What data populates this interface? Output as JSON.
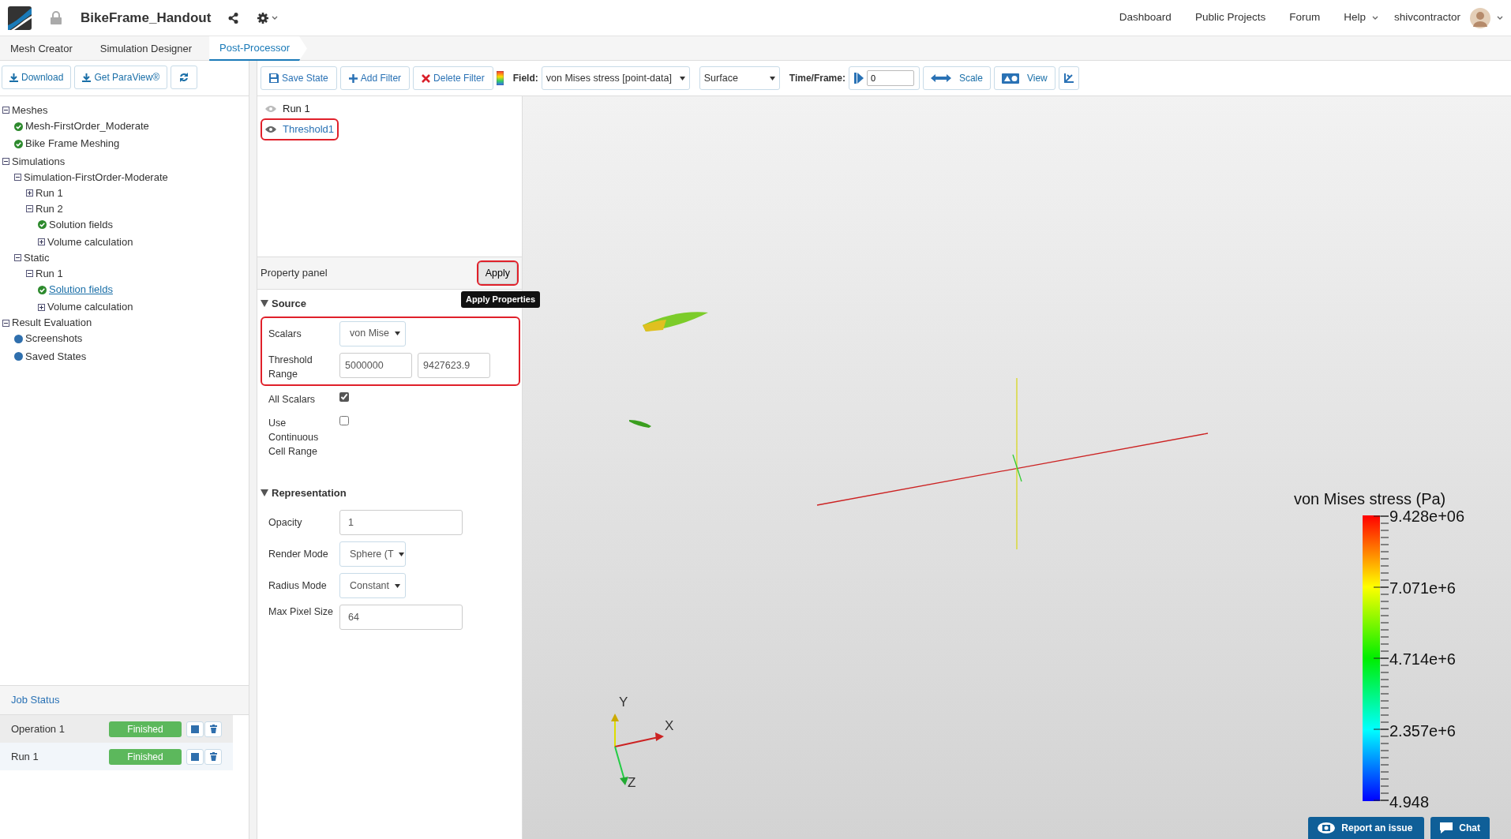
{
  "header": {
    "project_title": "BikeFrame_Handout",
    "nav_links": [
      "Dashboard",
      "Public Projects",
      "Forum",
      "Help"
    ],
    "username": "shivcontractor"
  },
  "tabs": [
    {
      "label": "Mesh Creator",
      "selected": false
    },
    {
      "label": "Simulation Designer",
      "selected": false
    },
    {
      "label": "Post-Processor",
      "selected": true
    }
  ],
  "left_toolbar": {
    "buttons": [
      "Download",
      "Get ParaView®"
    ]
  },
  "tree": [
    {
      "label": "Meshes",
      "kind": "group",
      "expanded": true,
      "selected": false,
      "children": [
        {
          "label": "Mesh-FirstOrder_Moderate",
          "kind": "done",
          "selected": false
        },
        {
          "label": "Bike Frame Meshing",
          "kind": "done",
          "selected": false
        }
      ]
    },
    {
      "label": "Simulations",
      "kind": "group",
      "expanded": true,
      "selected": false,
      "children": [
        {
          "label": "Simulation-FirstOrder-Moderate",
          "kind": "group",
          "expanded": true,
          "selected": false,
          "children": [
            {
              "label": "Run 1",
              "kind": "group",
              "expanded": false,
              "selected": false
            },
            {
              "label": "Run 2",
              "kind": "group",
              "expanded": true,
              "selected": false,
              "children": [
                {
                  "label": "Solution fields",
                  "kind": "done",
                  "selected": false
                },
                {
                  "label": "Volume calculation",
                  "kind": "group",
                  "expanded": false,
                  "selected": false
                }
              ]
            }
          ]
        },
        {
          "label": "Static",
          "kind": "group",
          "expanded": true,
          "selected": false,
          "children": [
            {
              "label": "Run 1",
              "kind": "group",
              "expanded": true,
              "selected": false,
              "children": [
                {
                  "label": "Solution fields",
                  "kind": "done",
                  "selected": true
                },
                {
                  "label": "Volume calculation",
                  "kind": "group",
                  "expanded": false,
                  "selected": false
                }
              ]
            }
          ]
        }
      ]
    },
    {
      "label": "Result Evaluation",
      "kind": "group",
      "expanded": true,
      "selected": false,
      "children": [
        {
          "label": "Screenshots",
          "kind": "dot",
          "selected": false
        },
        {
          "label": "Saved States",
          "kind": "dot",
          "selected": false
        }
      ]
    }
  ],
  "job_status": {
    "title": "Job Status",
    "jobs": [
      {
        "name": "Operation 1",
        "status": "Finished"
      },
      {
        "name": "Run 1",
        "status": "Finished"
      }
    ]
  },
  "toolbar": {
    "buttons": [
      {
        "kind": "save",
        "label": "Save State"
      },
      {
        "kind": "add",
        "label": "Add Filter"
      },
      {
        "kind": "delete",
        "label": "Delete Filter"
      }
    ],
    "field_label": "Field:",
    "field_value": "von Mises stress [point-data]",
    "representation": "Surface",
    "time_label": "Time/Frame:",
    "time_value": "0",
    "scale_label": "Scale",
    "view_label": "View"
  },
  "pipeline": [
    {
      "label": "Run 1",
      "selected": false,
      "highlighted": false
    },
    {
      "label": "Threshold1",
      "selected": true,
      "highlighted": true
    }
  ],
  "property_panel": {
    "title": "Property panel",
    "apply_label": "Apply",
    "apply_highlighted": true,
    "tooltip": "Apply Properties",
    "sections": [
      {
        "title": "Source",
        "expanded": true,
        "rows": [
          {
            "kind": "select",
            "label": "Scalars",
            "value": "von Mise",
            "highlighted": true
          },
          {
            "kind": "range",
            "label": "Threshold Range",
            "values": [
              "5000000",
              "9427623.9"
            ],
            "highlighted": true
          },
          {
            "kind": "checkbox",
            "label": "All Scalars",
            "checked": true,
            "highlighted": false
          },
          {
            "kind": "checkbox",
            "label": "Use Continuous Cell Range",
            "checked": false,
            "highlighted": false
          }
        ]
      },
      {
        "title": "Representation",
        "expanded": true,
        "rows": [
          {
            "kind": "input",
            "label": "Opacity",
            "value": "1",
            "highlighted": false
          },
          {
            "kind": "select",
            "label": "Render Mode",
            "value": "Sphere (T",
            "highlighted": false
          },
          {
            "kind": "select",
            "label": "Radius Mode",
            "value": "Constant",
            "highlighted": false
          },
          {
            "kind": "input",
            "label": "Max Pixel Size",
            "value": "64",
            "highlighted": false
          }
        ]
      }
    ]
  },
  "viewport": {
    "legend": {
      "title": "von Mises stress (Pa)",
      "ticks": [
        "9.428e+06",
        "7.071e+6",
        "4.714e+6",
        "2.357e+6",
        "4.948"
      ]
    },
    "axes": [
      "Y",
      "X",
      "Z"
    ]
  },
  "support_buttons": [
    {
      "kind": "report",
      "label": "Report an issue"
    },
    {
      "kind": "chat",
      "label": "Chat"
    }
  ]
}
